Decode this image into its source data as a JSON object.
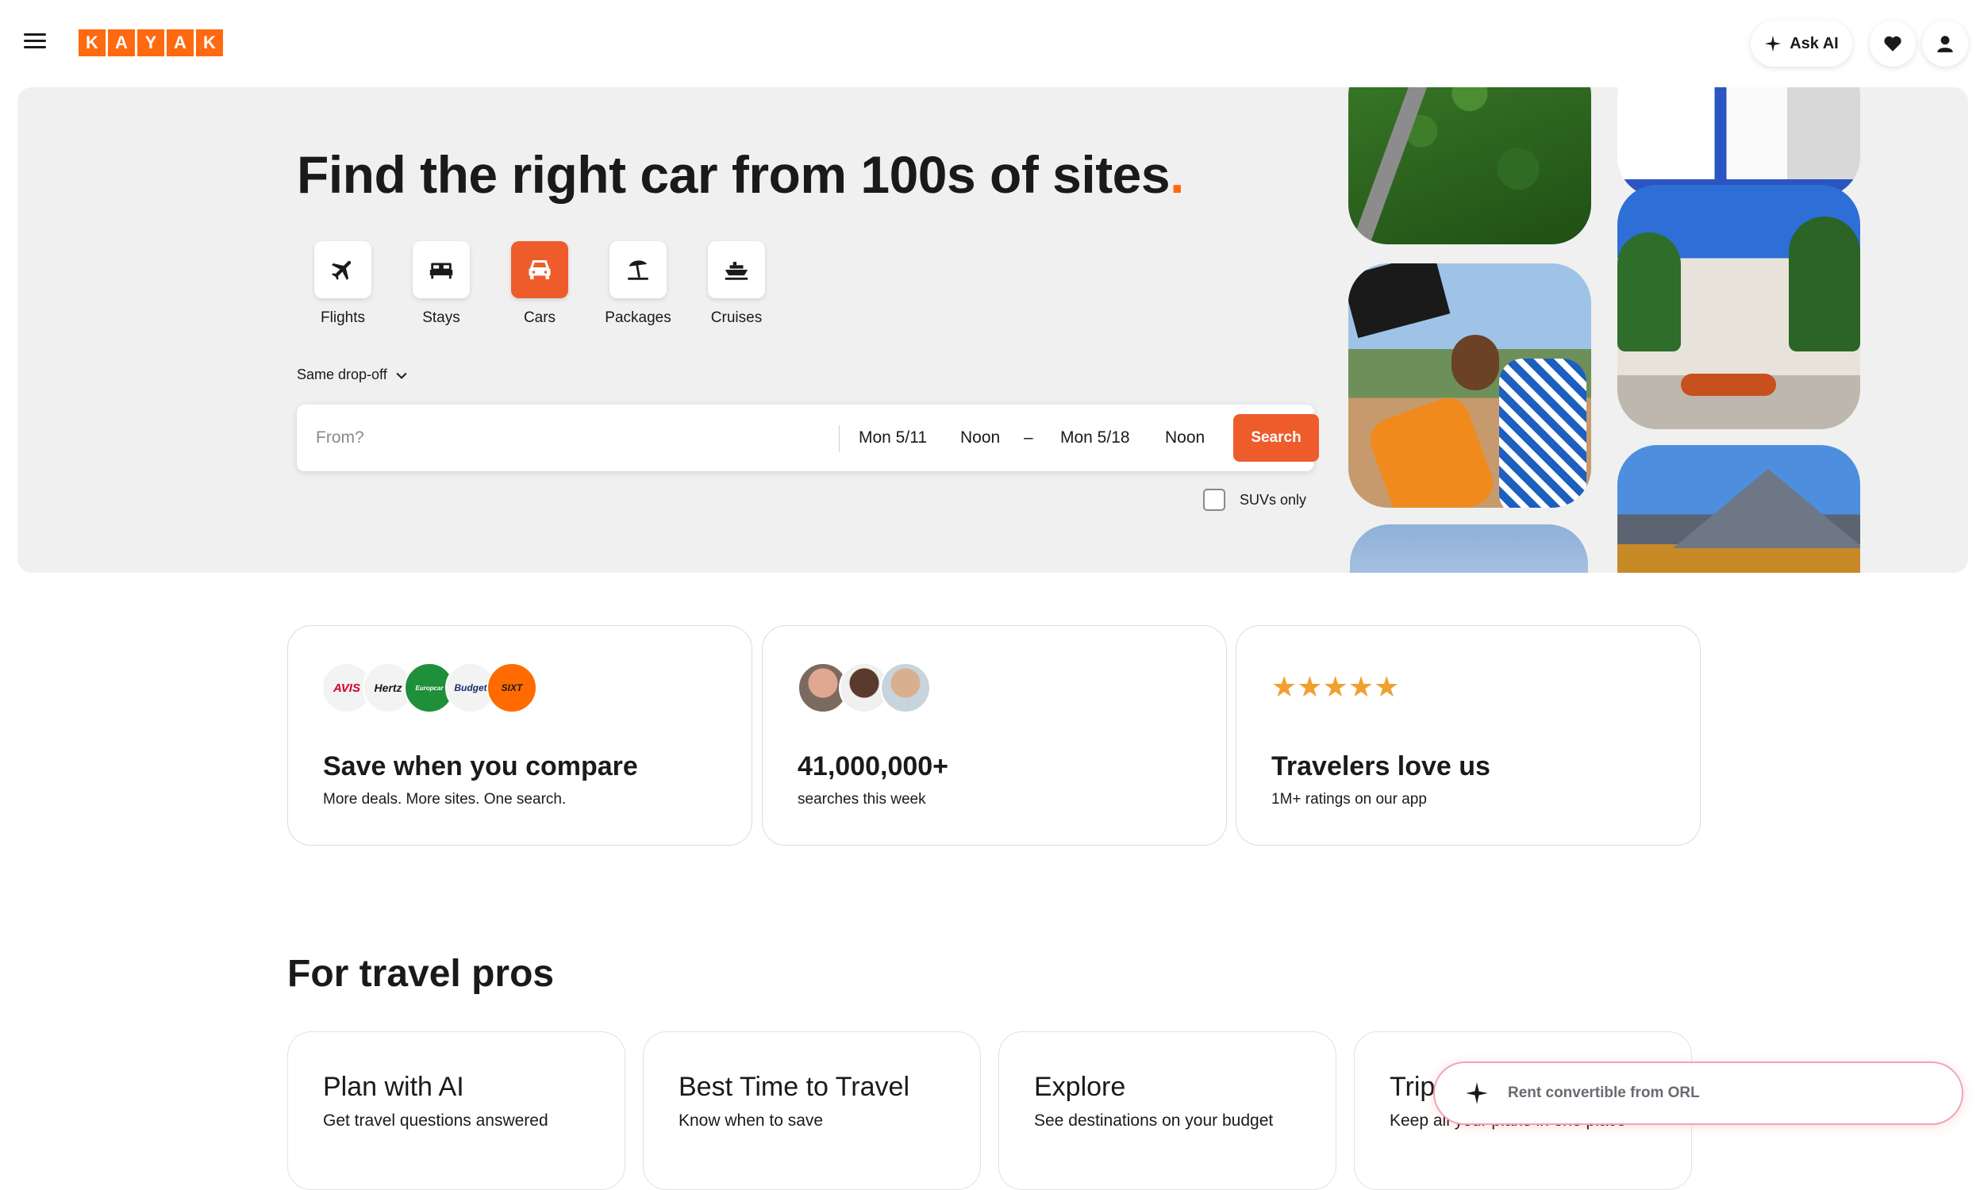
{
  "header": {
    "logo_letters": [
      "K",
      "A",
      "Y",
      "A",
      "K"
    ],
    "ask_ai_label": "Ask AI",
    "icons": {
      "menu": "hamburger-menu-icon",
      "sparkle": "sparkle-icon",
      "favorites": "heart-icon",
      "account": "person-icon"
    }
  },
  "hero": {
    "title": "Find the right car from 100s of sites",
    "title_dot": ".",
    "verticals": [
      {
        "label": "Flights",
        "icon": "airplane-icon"
      },
      {
        "label": "Stays",
        "icon": "bed-icon"
      },
      {
        "label": "Cars",
        "icon": "car-icon",
        "active": true
      },
      {
        "label": "Packages",
        "icon": "beach-umbrella-icon"
      },
      {
        "label": "Cruises",
        "icon": "ship-icon"
      }
    ],
    "dropoff_label": "Same drop-off",
    "search": {
      "from_placeholder": "From?",
      "pickup_date": "Mon 5/11",
      "pickup_time": "Noon",
      "separator": "–",
      "dropoff_date": "Mon 5/18",
      "dropoff_time": "Noon",
      "search_label": "Search"
    },
    "suv_label": "SUVs only"
  },
  "stats": [
    {
      "title": "Save when you compare",
      "sub": "More deals. More sites. One search.",
      "logos": [
        "AVIS",
        "Hertz",
        "Europcar",
        "Budget",
        "SIXT"
      ]
    },
    {
      "title": "41,000,000+",
      "sub": "searches this week"
    },
    {
      "title": "Travelers love us",
      "sub": "1M+ ratings on our app",
      "stars": "★★★★★"
    }
  ],
  "pros": {
    "title": "For travel pros",
    "cards": [
      {
        "title": "Plan with AI",
        "sub": "Get travel questions answered"
      },
      {
        "title": "Best Time to Travel",
        "sub": "Know when to save"
      },
      {
        "title": "Explore",
        "sub": "See destinations on your budget"
      },
      {
        "title": "Trips",
        "sub": "Keep all your plans in one place"
      }
    ]
  },
  "ai_prompt": {
    "text": "Rent convertible from ORL"
  },
  "colors": {
    "brand": "#ff690f",
    "accent": "#ee5c2c",
    "hero_bg": "#f0f0f0",
    "star": "#f0a030"
  }
}
